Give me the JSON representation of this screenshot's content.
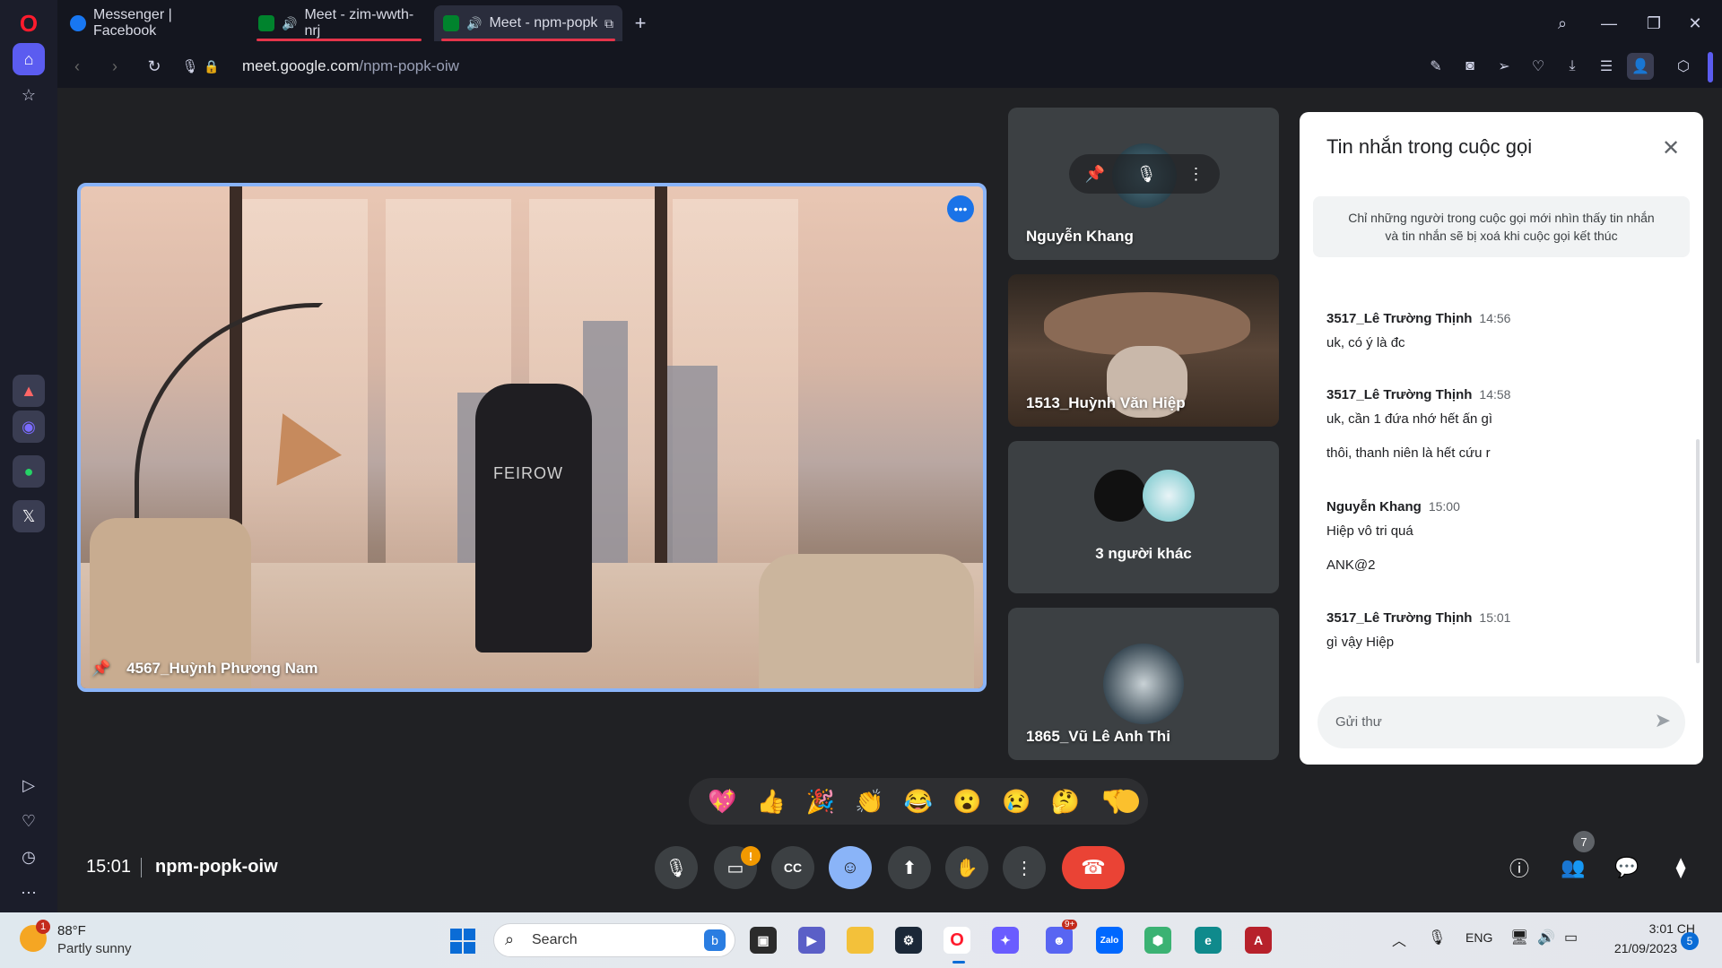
{
  "browser": {
    "tabs": [
      {
        "title": "Messenger | Facebook"
      },
      {
        "title": "Meet - zim-wwth-nrj"
      },
      {
        "title": "Meet - npm-popk"
      }
    ],
    "url_domain": "meet.google.com",
    "url_path": "/npm-popk-oiw"
  },
  "meet": {
    "main_participant": "4567_Huỳnh Phương Nam",
    "shirt_print": "FEIROW",
    "tiles": [
      {
        "name": "Nguyễn Khang"
      },
      {
        "name": "1513_Huỳnh Văn Hiệp"
      },
      {
        "name": "3 người khác"
      },
      {
        "name": "1865_Vũ Lê Anh Thi"
      }
    ],
    "reactions": [
      "💖",
      "👍",
      "🎉",
      "👏",
      "😂",
      "😮",
      "😢",
      "🤔",
      "👎"
    ],
    "clock": "15:01",
    "meeting_code": "npm-popk-oiw",
    "people_count": "7",
    "camera_warning": "!"
  },
  "chat": {
    "title": "Tin nhắn trong cuộc gọi",
    "note_line1": "Chỉ những người trong cuộc gọi mới nhìn thấy tin nhắn",
    "note_line2": "và tin nhắn sẽ bị xoá khi cuộc gọi kết thúc",
    "messages": [
      {
        "sender": "3517_Lê Trường Thịnh",
        "time": "14:56",
        "lines": [
          "uk, có ý là đc"
        ]
      },
      {
        "sender": "3517_Lê Trường Thịnh",
        "time": "14:58",
        "lines": [
          "uk, cần 1 đứa nhớ hết ấn gì",
          "thôi, thanh niên là hết cứu r"
        ]
      },
      {
        "sender": "Nguyễn Khang",
        "time": "15:00",
        "lines": [
          "Hiệp vô tri quá",
          "ANK@2"
        ]
      },
      {
        "sender": "3517_Lê Trường Thịnh",
        "time": "15:01",
        "lines": [
          "gì vậy Hiệp"
        ]
      }
    ],
    "input_placeholder": "Gửi thư"
  },
  "taskbar": {
    "weather_badge": "1",
    "temperature": "88°F",
    "condition": "Partly sunny",
    "search_label": "Search",
    "language": "ENG",
    "time": "3:01 CH",
    "date": "21/09/2023",
    "notification_count": "5",
    "discord_badge": "9+",
    "zalo_label": "Zalo"
  },
  "colors": {
    "accent_blue": "#8ab4f8",
    "end_call_red": "#ea4335",
    "opera_red": "#e5344a"
  }
}
